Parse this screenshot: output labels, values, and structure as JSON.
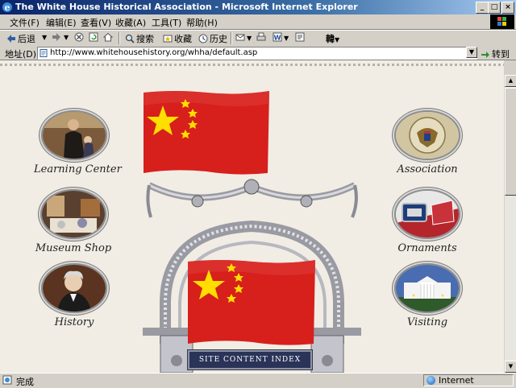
{
  "window": {
    "title": "The White House Historical Association - Microsoft Internet Explorer",
    "minimize": "_",
    "maximize": "□",
    "close": "×"
  },
  "menu": [
    "文件(F)",
    "编辑(E)",
    "查看(V)",
    "收藏(A)",
    "工具(T)",
    "帮助(H)"
  ],
  "toolbar": {
    "back": "后退",
    "search": "搜索",
    "favorites": "收藏",
    "history": "历史",
    "ime": "韓"
  },
  "address": {
    "label": "地址(D)",
    "url": "http://www.whitehousehistory.org/whha/default.asp",
    "go": "转到"
  },
  "nav_left": [
    {
      "label": "Learning Center"
    },
    {
      "label": "Museum Shop"
    },
    {
      "label": "History"
    }
  ],
  "nav_right": [
    {
      "label": "Association"
    },
    {
      "label": "Ornaments"
    },
    {
      "label": "Visiting"
    }
  ],
  "site_index": "SITE CONTENT INDEX",
  "status": {
    "text": "完成",
    "zone": "Internet"
  },
  "colors": {
    "flag_red": "#d71f1c",
    "flag_star": "#ffde00",
    "page_bg": "#f1ede4"
  },
  "icons": {
    "back": "arrow-left-icon",
    "forward": "arrow-right-icon",
    "stop": "stop-icon",
    "refresh": "refresh-icon",
    "home": "home-icon",
    "search": "search-icon",
    "favorites": "favorites-icon",
    "history": "history-icon",
    "mail": "mail-icon",
    "print": "print-icon",
    "edit": "word-icon",
    "discuss": "discuss-icon"
  }
}
